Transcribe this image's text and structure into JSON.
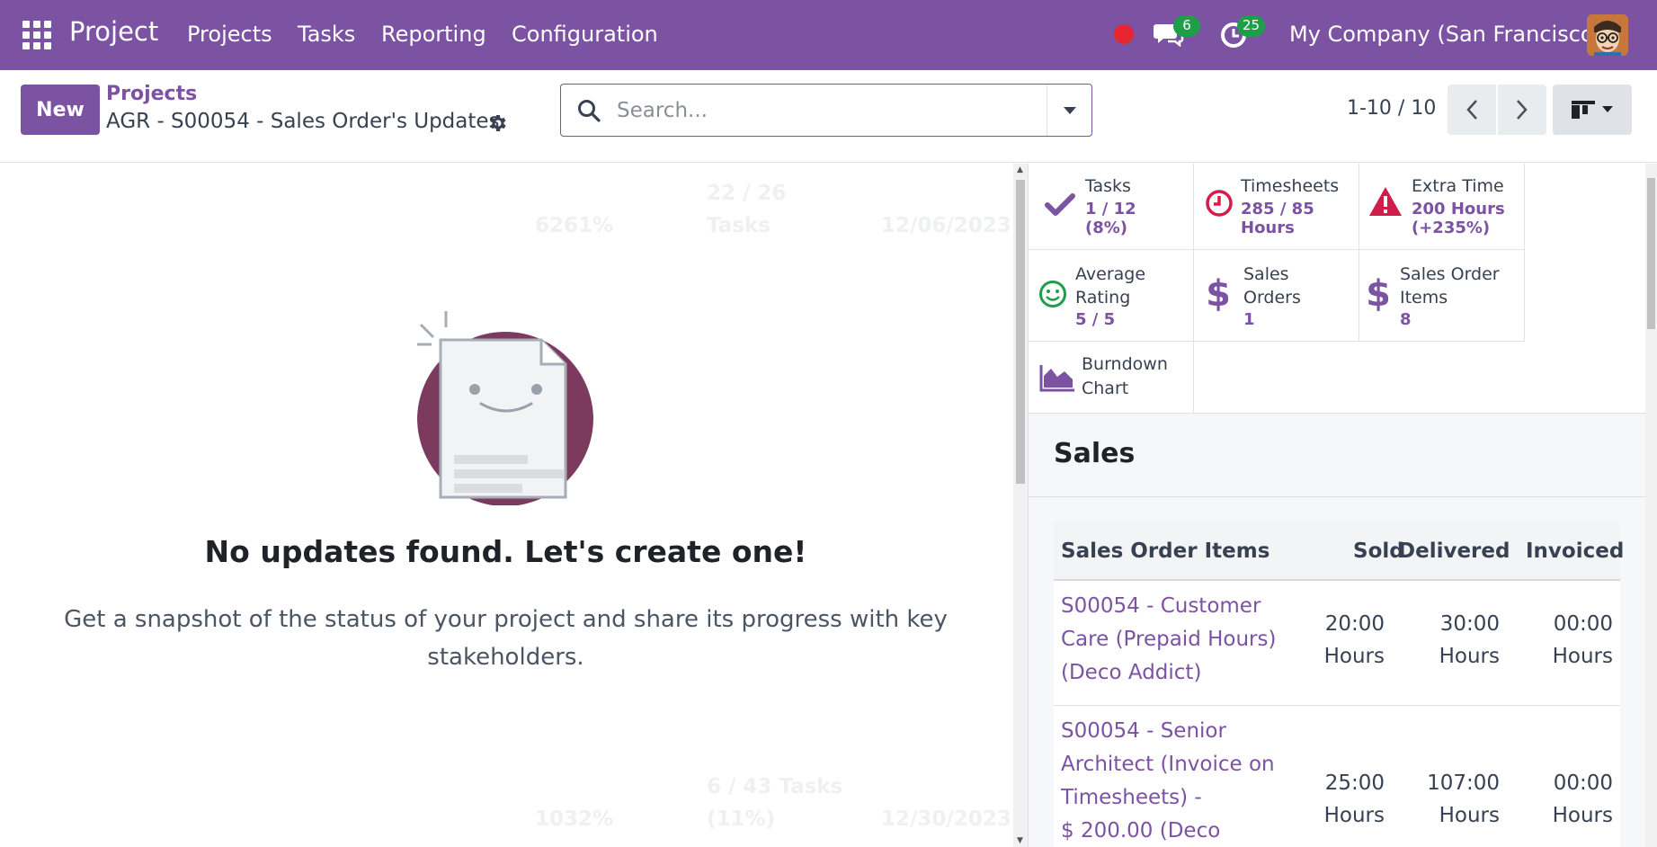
{
  "navbar": {
    "brand": "Project",
    "menu": [
      "Projects",
      "Tasks",
      "Reporting",
      "Configuration"
    ],
    "messages_count": "6",
    "activities_count": "25",
    "company": "My Company (San Francisco)",
    "accent": "#7c52a3"
  },
  "control_panel": {
    "new_label": "New",
    "breadcrumb_parent": "Projects",
    "breadcrumb_current": "AGR - S00054 - Sales Order's Updates",
    "search_placeholder": "Search...",
    "pager": "1-10 / 10"
  },
  "background_ghost": {
    "r1_pct": "6261%",
    "r1_tasks_a": "22 / 26",
    "r1_tasks_b": "Tasks",
    "r1_date": "12/06/2023",
    "r2_pct": "1032%",
    "r2_tasks": "6 / 43 Tasks",
    "r2_tasks_pct": "(11%)",
    "r2_date": "12/30/2023"
  },
  "empty_state": {
    "title": "No updates found. Let's create one!",
    "text": "Get a snapshot of the status of your project and share its progress with key stakeholders."
  },
  "stats": {
    "tasks": {
      "label": "Tasks",
      "value_1": "1 / 12",
      "value_2": "(8%)"
    },
    "timesheets": {
      "label": "Timesheets",
      "value_1": "285 / 85",
      "value_2": "Hours"
    },
    "extra_time": {
      "label": "Extra Time",
      "value_1": "200 Hours",
      "value_2": "(+235%)"
    },
    "rating": {
      "label_1": "Average",
      "label_2": "Rating",
      "value": "5 / 5"
    },
    "sales_orders": {
      "label_1": "Sales",
      "label_2": "Orders",
      "value": "1"
    },
    "so_items": {
      "label_1": "Sales Order",
      "label_2": "Items",
      "value": "8"
    },
    "burndown": {
      "label_1": "Burndown",
      "label_2": "Chart"
    }
  },
  "sales": {
    "heading": "Sales",
    "columns": [
      "Sales Order Items",
      "Sold",
      "Delivered",
      "Invoiced"
    ],
    "rows": [
      {
        "item_lines": [
          "S00054 - Customer",
          "Care (Prepaid Hours)",
          "(Deco Addict)"
        ],
        "sold": [
          "20:00",
          "Hours"
        ],
        "delivered": [
          "30:00",
          "Hours"
        ],
        "invoiced": [
          "00:00",
          "Hours"
        ]
      },
      {
        "item_lines": [
          "S00054 - Senior",
          "Architect (Invoice on",
          "Timesheets) -",
          "$ 200.00 (Deco"
        ],
        "sold": [
          "25:00",
          "Hours"
        ],
        "delivered": [
          "107:00",
          "Hours"
        ],
        "invoiced": [
          "00:00",
          "Hours"
        ]
      }
    ]
  }
}
